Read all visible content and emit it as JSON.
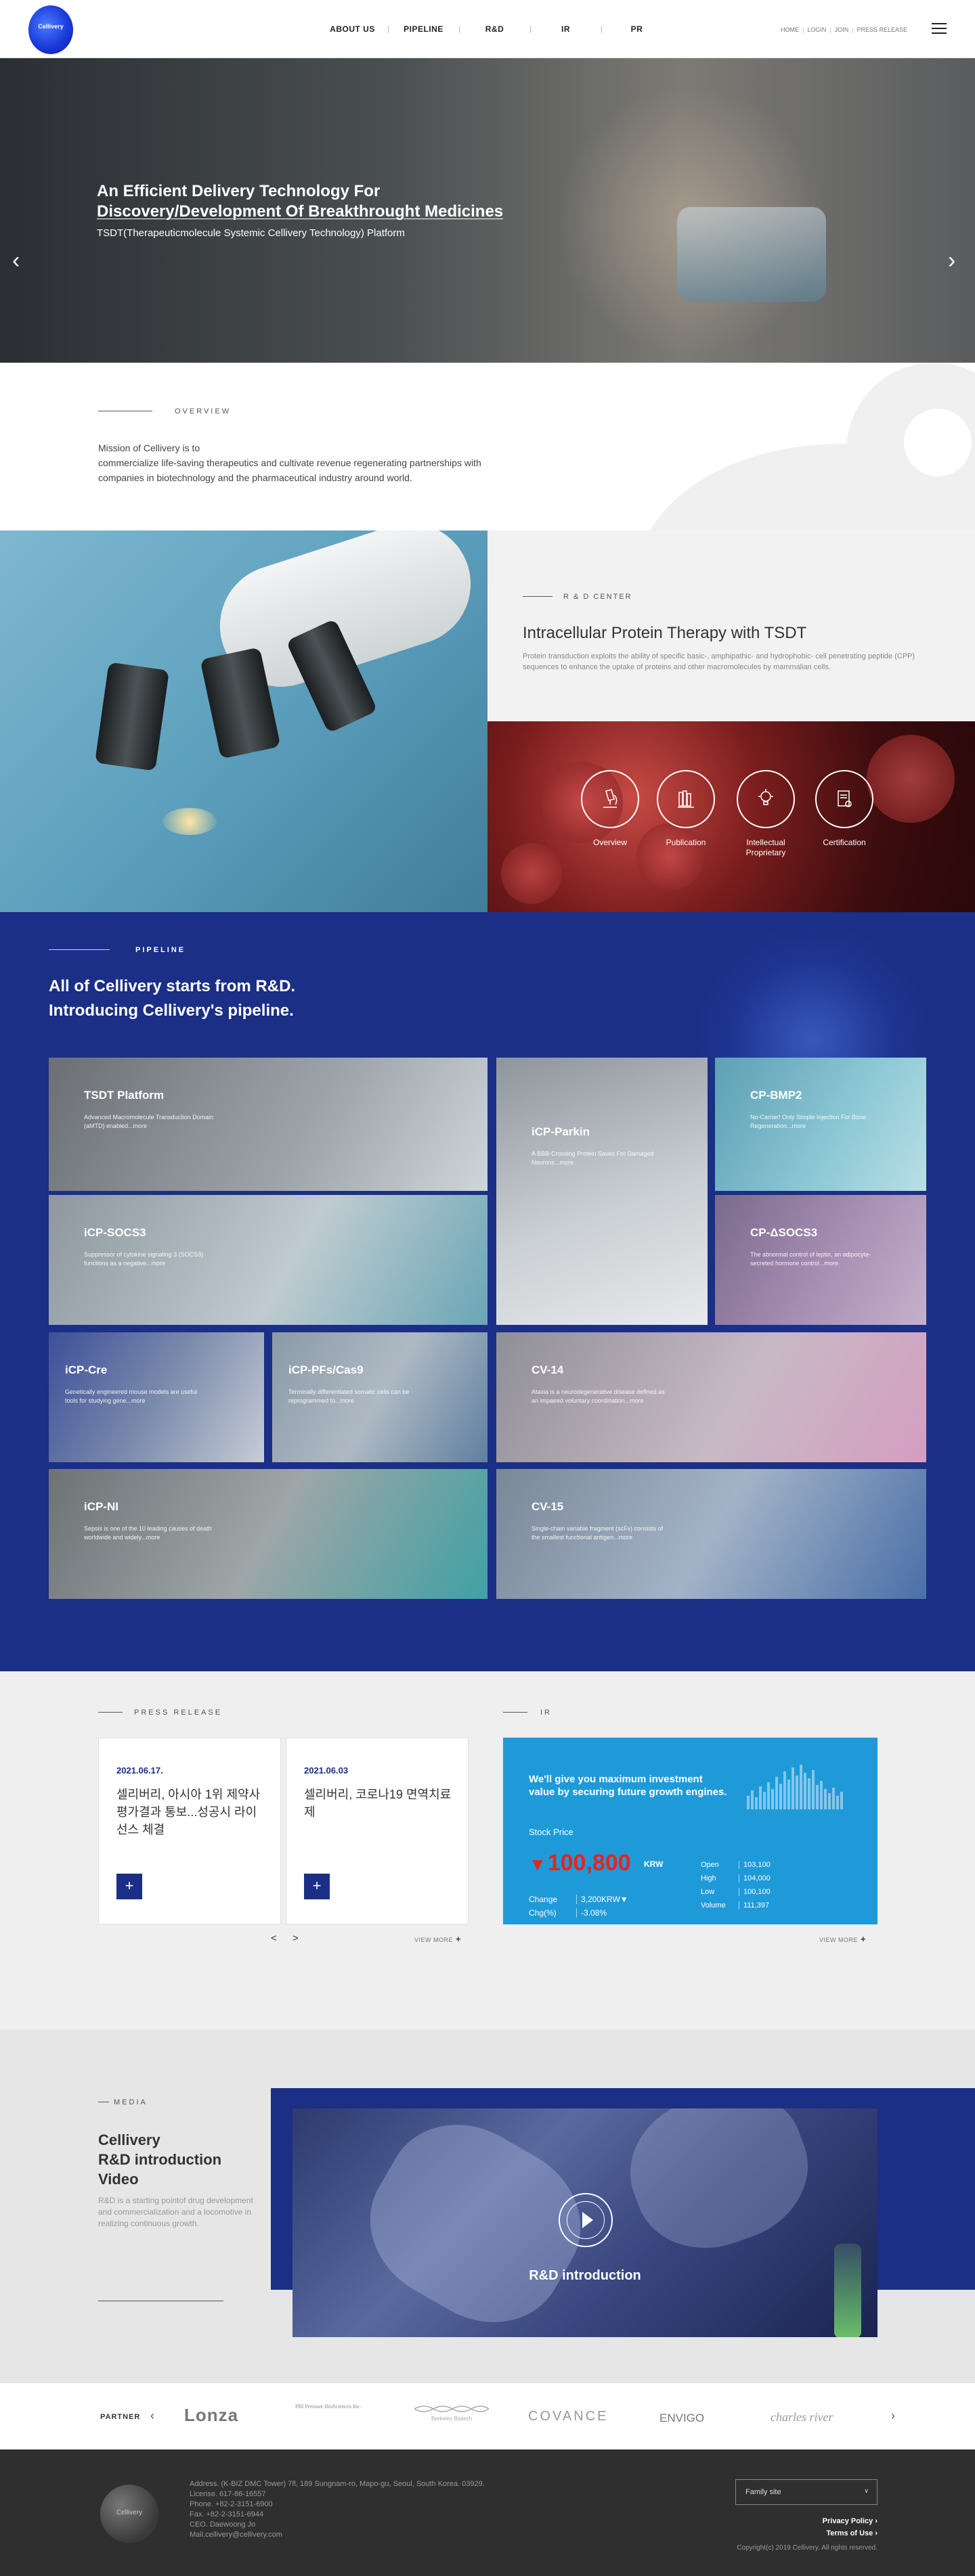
{
  "header": {
    "logo_text": "Cellivery",
    "nav": [
      "ABOUT US",
      "PIPELINE",
      "R&D",
      "IR",
      "PR"
    ],
    "util": [
      "HOME",
      "LOGIN",
      "JOIN",
      "PRESS RELEASE"
    ]
  },
  "hero": {
    "title_line1": "An Efficient Delivery Technology For",
    "title_line2": "Discovery/Development Of Breakthrought Medicines",
    "subtitle": "TSDT(Therapeuticmolecule Systemic Cellivery Technology) Platform",
    "prev": "‹",
    "next": "›"
  },
  "overview": {
    "label": "OVERVIEW",
    "text_line1": "Mission of Cellivery is to",
    "text_line2": "commercialize life-saving therapeutics and cultivate revenue regenerating partnerships with",
    "text_line3": "companies in biotechnology and the pharmaceutical industry around world."
  },
  "rnd": {
    "label": "R & D CENTER",
    "title": "Intracellular Protein Therapy with TSDT",
    "desc": "Protein transduction exploits the ability of specific basic-, amphipathic- and hydrophobic- cell penetrating peptide (CPP) sequences to enhance the uptake of proteins and other macromolecules by mammalian cells.",
    "icons": [
      {
        "label": "Overview",
        "icon": "microscope-icon"
      },
      {
        "label": "Publication",
        "icon": "books-icon"
      },
      {
        "label": "Intellectual Proprietary",
        "icon": "lightbulb-gear-icon"
      },
      {
        "label": "Certification",
        "icon": "certificate-icon"
      }
    ]
  },
  "pipeline": {
    "label": "PIPELINE",
    "title_line1": "All of Cellivery starts from R&D.",
    "title_line2": "Introducing Cellivery's pipeline.",
    "tiles": [
      {
        "name": "TSDT Platform",
        "desc": "Advanced Macromolecule Transduction Domain (aMTD) enabled...more"
      },
      {
        "name": "iCP-Parkin",
        "desc": "A BBB-Crossing Protein Saves For Damaged Neurons...more"
      },
      {
        "name": "CP-BMP2",
        "desc": "No-Carrier! Only Simple Injection For Bone Regeneration...more"
      },
      {
        "name": "iCP-SOCS3",
        "desc": "Suppressor of cytokine signaling 3 (SOCS3) functions as a negative...more"
      },
      {
        "name": "CP-ΔSOCS3",
        "desc": "The abnormal control of leptin, an adipocyte-secreted hormone control...more"
      },
      {
        "name": "iCP-Cre",
        "desc": "Genetically engineered mouse models are useful tools for studying gene...more"
      },
      {
        "name": "iCP-PFs/Cas9",
        "desc": "Terminally differentiated somatic cells can be reprogrammed to...more"
      },
      {
        "name": "CV-14",
        "desc": "Ataxia is a neurodegenerative disease defined as an impaired voluntary coordination...more"
      },
      {
        "name": "iCP-NI",
        "desc": "Sepsis is one of the 10 leading causes of death worldwide and widely...more"
      },
      {
        "name": "CV-15",
        "desc": "Single-chain variable fragment (scFv) consists of the smallest functional antigen...more"
      }
    ]
  },
  "press": {
    "label": "PRESS RELEASE",
    "cards": [
      {
        "date": "2021.06.17.",
        "title": "셀리버리, 아시아 1위 제약사 평가결과 통보...성공시 라이선스 체결"
      },
      {
        "date": "2021.06.03",
        "title": "셀리버리, 코로나19 면역치료제"
      }
    ],
    "prev": "<",
    "next": ">",
    "view_more": "VIEW MORE"
  },
  "ir": {
    "label": "IR",
    "headline_line1": "We'll give you maximum investment",
    "headline_line2": "value by securing future growth engines.",
    "stock_label": "Stock Price",
    "price": "100,800",
    "currency": "KRW",
    "change_label": "Change",
    "change_value": "3,200KRW▼",
    "chg_label": "Chg(%)",
    "chg_value": "-3.08%",
    "open_label": "Open",
    "open_value": "103,100",
    "high_label": "High",
    "high_value": "104,000",
    "low_label": "Low",
    "low_value": "100,100",
    "volume_label": "Volume",
    "volume_value": "111,397",
    "view_more": "VIEW MORE",
    "colors": {
      "card": "#1f9ad9",
      "down": "#e8231a"
    }
  },
  "media": {
    "label": "MEDIA",
    "title_line1": "Cellivery",
    "title_line2": "R&D introduction",
    "title_line3": "Video",
    "desc": "R&D is a starting pointof drug development and commercialization and a locomotive in realizing continuous growth.",
    "video_label": "R&D introduction"
  },
  "partner": {
    "label": "PARTNER",
    "prev": "‹",
    "next": "›",
    "logos": [
      "Lonza",
      "PBI Pressure BioSciences Inc.",
      "Berkeley Biotech",
      "COVANCE",
      "ENVIGO",
      "charles river"
    ]
  },
  "footer": {
    "logo_text": "Cellivery",
    "address": "Address. (K-BIZ DMC Tower) 7fl, 189 Sungnam-ro, Mapo-gu, Seoul, South Korea. 03929.",
    "license": "License. 617-86-16557",
    "phone": "Phone. +82-2-3151-6900",
    "fax": "Fax. +82-2-3151-6944",
    "ceo": "CEO. Daewoong Jo",
    "mail": "Mail.cellivery@cellivery.com",
    "family_site": "Family site",
    "privacy": "Privacy Policy ›",
    "terms": "Terms of Use ›",
    "copyright": "Copyright(c) 2019 Cellivery. All rights reserved."
  },
  "theme": {
    "navy": "#1b2f86",
    "sky": "#1f9ad9"
  }
}
